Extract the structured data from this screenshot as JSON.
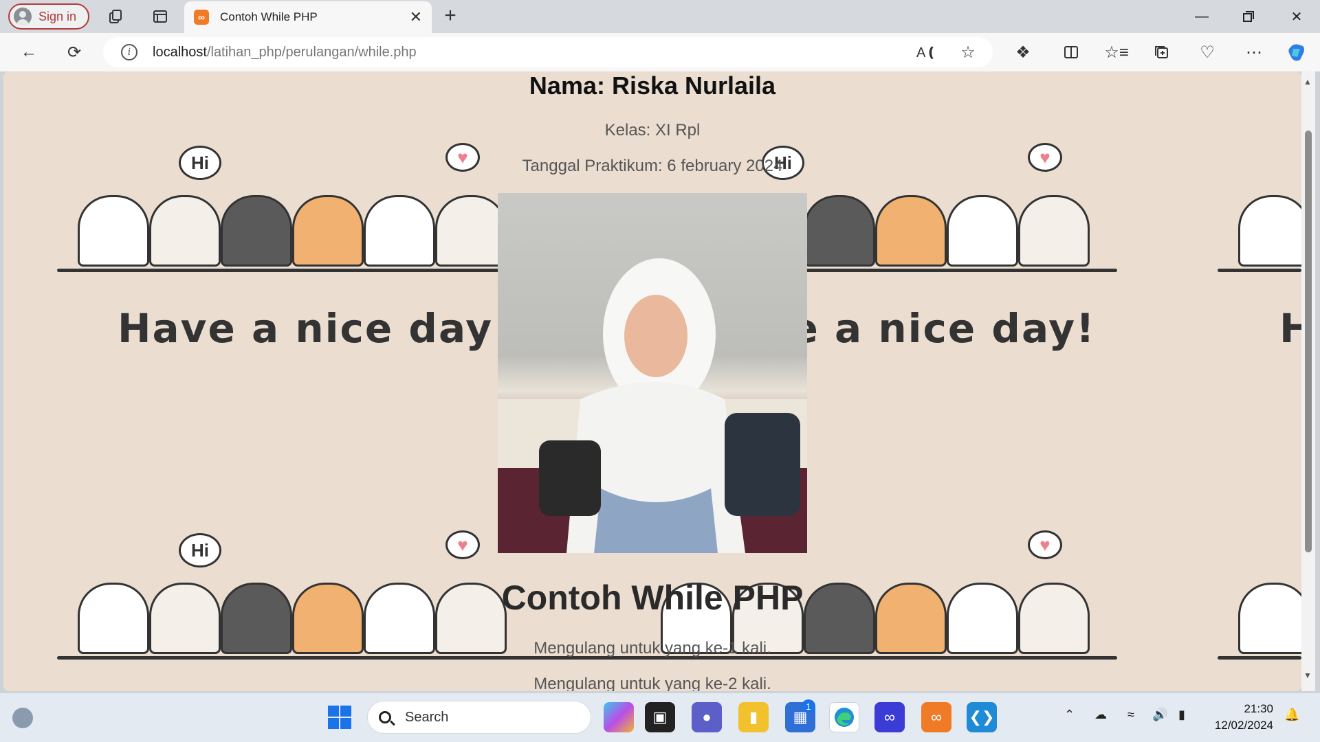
{
  "browser": {
    "signin_label": "Sign in",
    "tab_title": "Contoh While PHP",
    "tab_favicon": "xampp-icon",
    "url_host": "localhost",
    "url_path": "/latihan_php/perulangan/while.php"
  },
  "page": {
    "nama": "Nama: Riska Nurlaila",
    "kelas": "Kelas: XI Rpl",
    "tanggal": "Tanggal Praktikum: 6 february 2024",
    "heading": "Contoh While PHP",
    "lines": [
      "Mengulang untuk yang ke-1 kali.",
      "Mengulang untuk yang ke-2 kali."
    ],
    "background": {
      "slogan": "Have a nice day!",
      "bubble": "Hi",
      "heart": "♥"
    }
  },
  "taskbar": {
    "search_placeholder": "Search",
    "store_badge": "1",
    "time": "21:30",
    "date": "12/02/2024"
  },
  "colors": {
    "page_bg": "#ebded1",
    "accent_red": "#b43a3a",
    "heart_pink": "#ee7f8c"
  }
}
